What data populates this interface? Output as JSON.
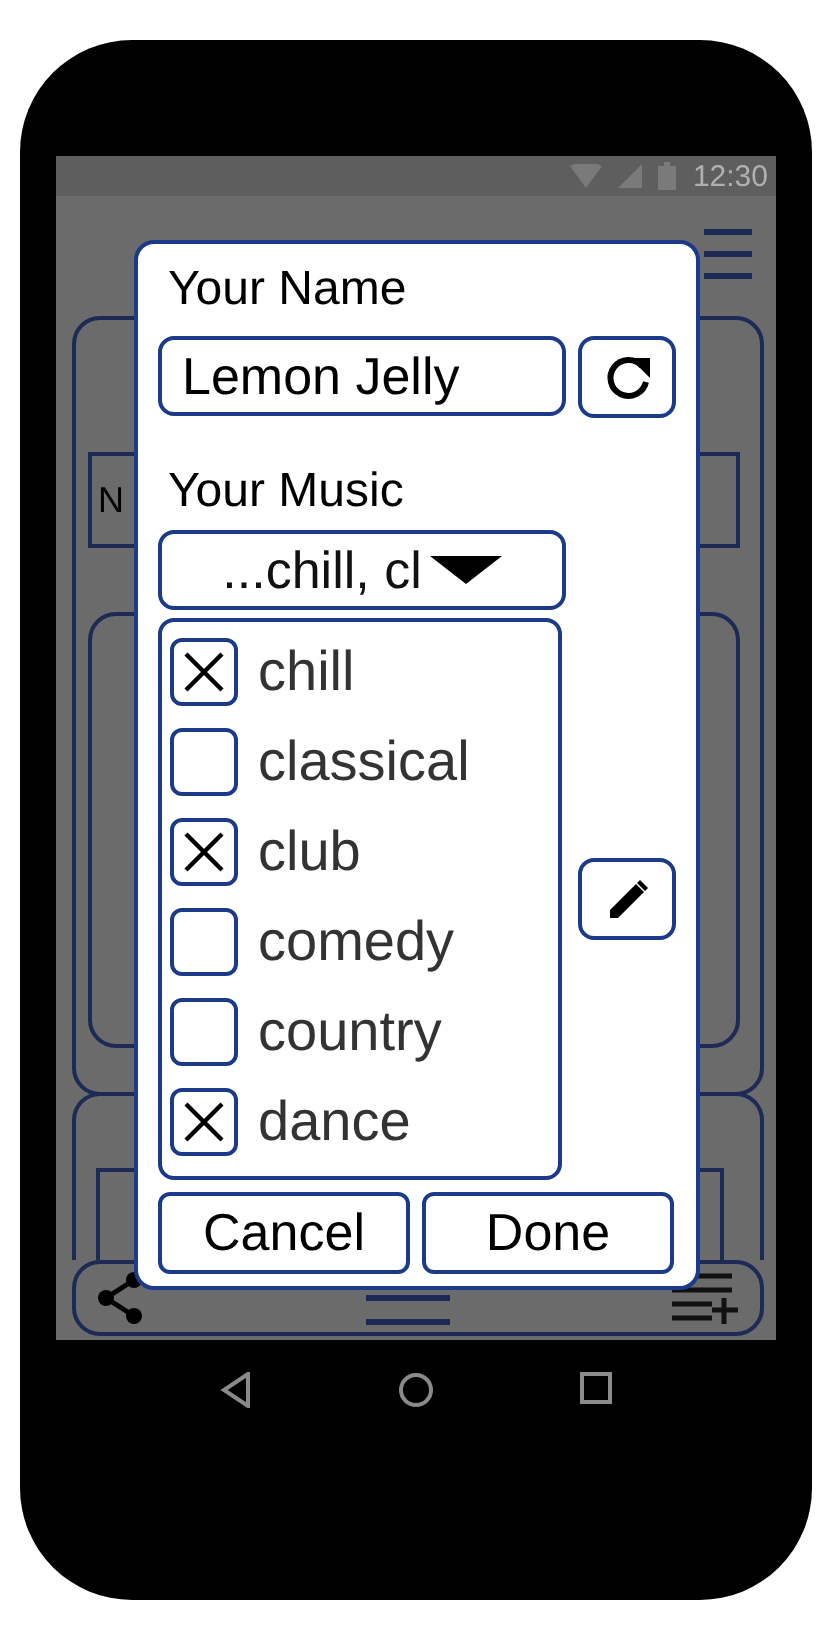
{
  "status_bar": {
    "time": "12:30"
  },
  "background": {
    "label": "N"
  },
  "dialog": {
    "name_label": "Your Name",
    "name_field": {
      "value": "Lemon Jelly"
    },
    "music_label": "Your Music",
    "music_dropdown": {
      "value": "...chill, cl"
    },
    "genres": [
      {
        "label": "chill",
        "checked": true
      },
      {
        "label": "classical",
        "checked": false
      },
      {
        "label": "club",
        "checked": true
      },
      {
        "label": "comedy",
        "checked": false
      },
      {
        "label": "country",
        "checked": false
      },
      {
        "label": "dance",
        "checked": true
      }
    ],
    "buttons": [
      {
        "label": "Cancel"
      },
      {
        "label": "Done"
      }
    ]
  }
}
